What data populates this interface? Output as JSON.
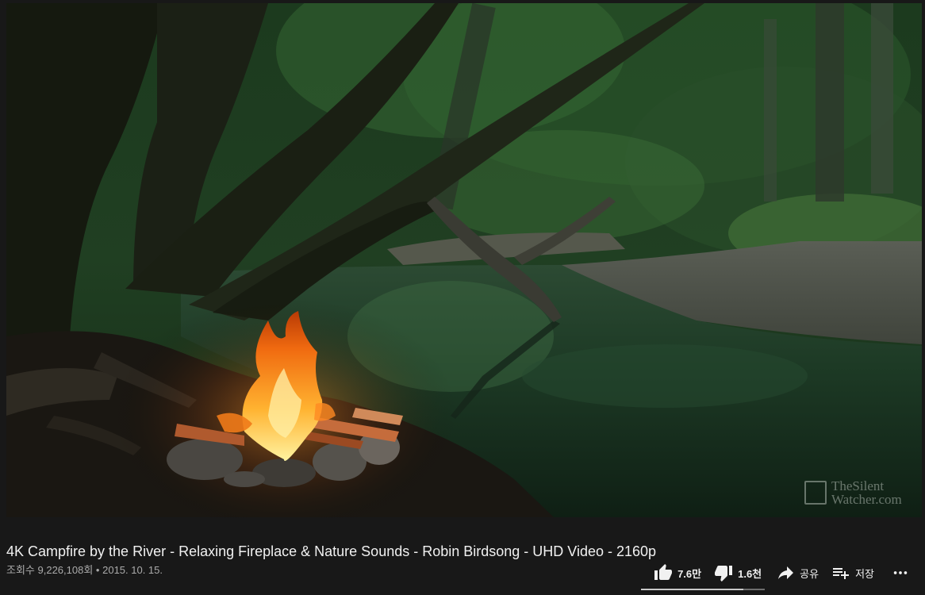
{
  "video": {
    "title": "4K Campfire by the River - Relaxing Fireplace & Nature Sounds - Robin Birdsong - UHD Video - 2160p",
    "views": "조회수 9,226,108회",
    "separator": "•",
    "date": "2015. 10. 15.",
    "watermark": "TheSilent Watcher.com"
  },
  "actions": {
    "like_count": "7.6만",
    "dislike_count": "1.6천",
    "share_label": "공유",
    "save_label": "저장",
    "more_icon": "more-horizontal-icon",
    "like_ratio": 0.826
  },
  "colors": {
    "background": "#181818",
    "text_primary": "#f1f1f1",
    "text_secondary": "#aaaaaa",
    "sentiment_bar": "#c8c8c8"
  }
}
